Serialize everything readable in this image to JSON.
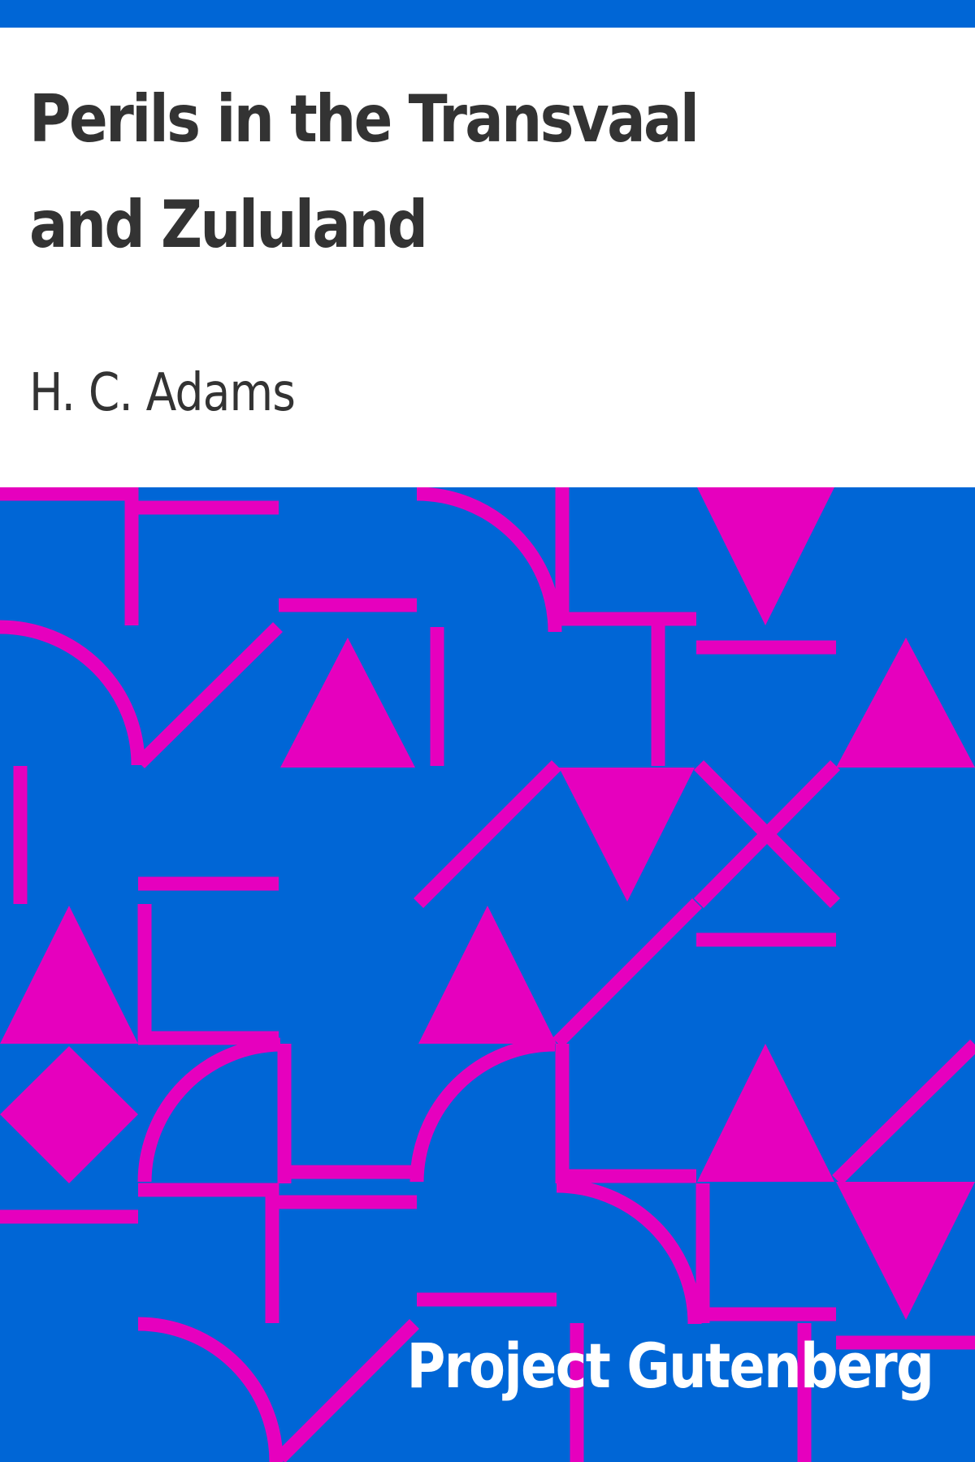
{
  "book": {
    "title": "Perils in the Transvaal and Zululand",
    "author": "H. C. Adams"
  },
  "publisher": {
    "name": "Project Gutenberg"
  },
  "colors": {
    "blue": "#0066d6",
    "magenta": "#e600be",
    "title_text": "#333333",
    "publisher_text": "#ffffff"
  }
}
